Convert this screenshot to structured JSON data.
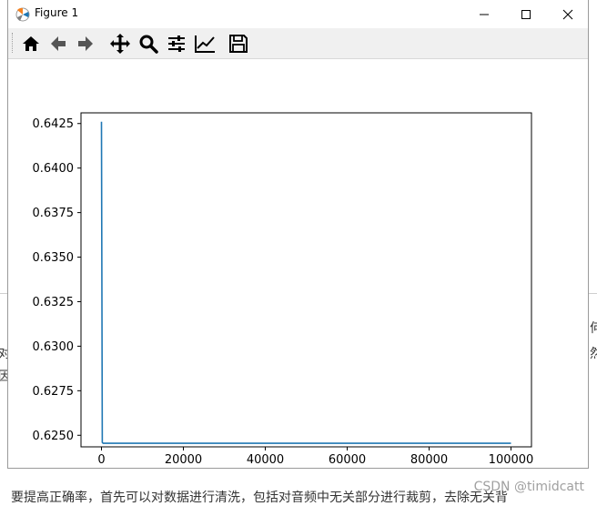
{
  "window": {
    "title": "Figure 1"
  },
  "toolbar": {
    "buttons": [
      {
        "name": "home-icon"
      },
      {
        "name": "back-arrow-icon"
      },
      {
        "name": "forward-arrow-icon"
      },
      {
        "name": "pan-icon"
      },
      {
        "name": "zoom-icon"
      },
      {
        "name": "subplots-config-icon"
      },
      {
        "name": "edit-axis-icon"
      },
      {
        "name": "save-icon"
      }
    ]
  },
  "chart_data": {
    "type": "line",
    "title": "",
    "xlabel": "",
    "ylabel": "",
    "xlim": [
      -5000,
      105000
    ],
    "ylim": [
      0.62435,
      0.6431
    ],
    "x_ticks": [
      "0",
      "20000",
      "40000",
      "60000",
      "80000",
      "100000"
    ],
    "x_tick_values": [
      0,
      20000,
      40000,
      60000,
      80000,
      100000
    ],
    "y_ticks": [
      "0.6250",
      "0.6275",
      "0.6300",
      "0.6325",
      "0.6350",
      "0.6375",
      "0.6400",
      "0.6425"
    ],
    "y_tick_values": [
      0.625,
      0.6275,
      0.63,
      0.6325,
      0.635,
      0.6375,
      0.64,
      0.6425
    ],
    "series": [
      {
        "color": "#1f77b4",
        "x": [
          0,
          200,
          400,
          1000,
          5000,
          20000,
          40000,
          60000,
          80000,
          100000
        ],
        "y": [
          0.6426,
          0.6246,
          0.62455,
          0.62455,
          0.62455,
          0.62455,
          0.62455,
          0.62455,
          0.62455,
          0.62455
        ]
      }
    ],
    "grid": false
  },
  "background_page": {
    "bottom_text": "要提高正确率，首先可以对数据进行清洗，包括对音频中无关部分进行裁剪，去除无关背",
    "left_fragments": [
      "对",
      "因"
    ],
    "right_fragments": [
      "何",
      "然"
    ],
    "watermark": "CSDN @timidcatt"
  },
  "colors": {
    "line": "#1f77b4",
    "toolbar_bg": "#f0f0f0"
  }
}
